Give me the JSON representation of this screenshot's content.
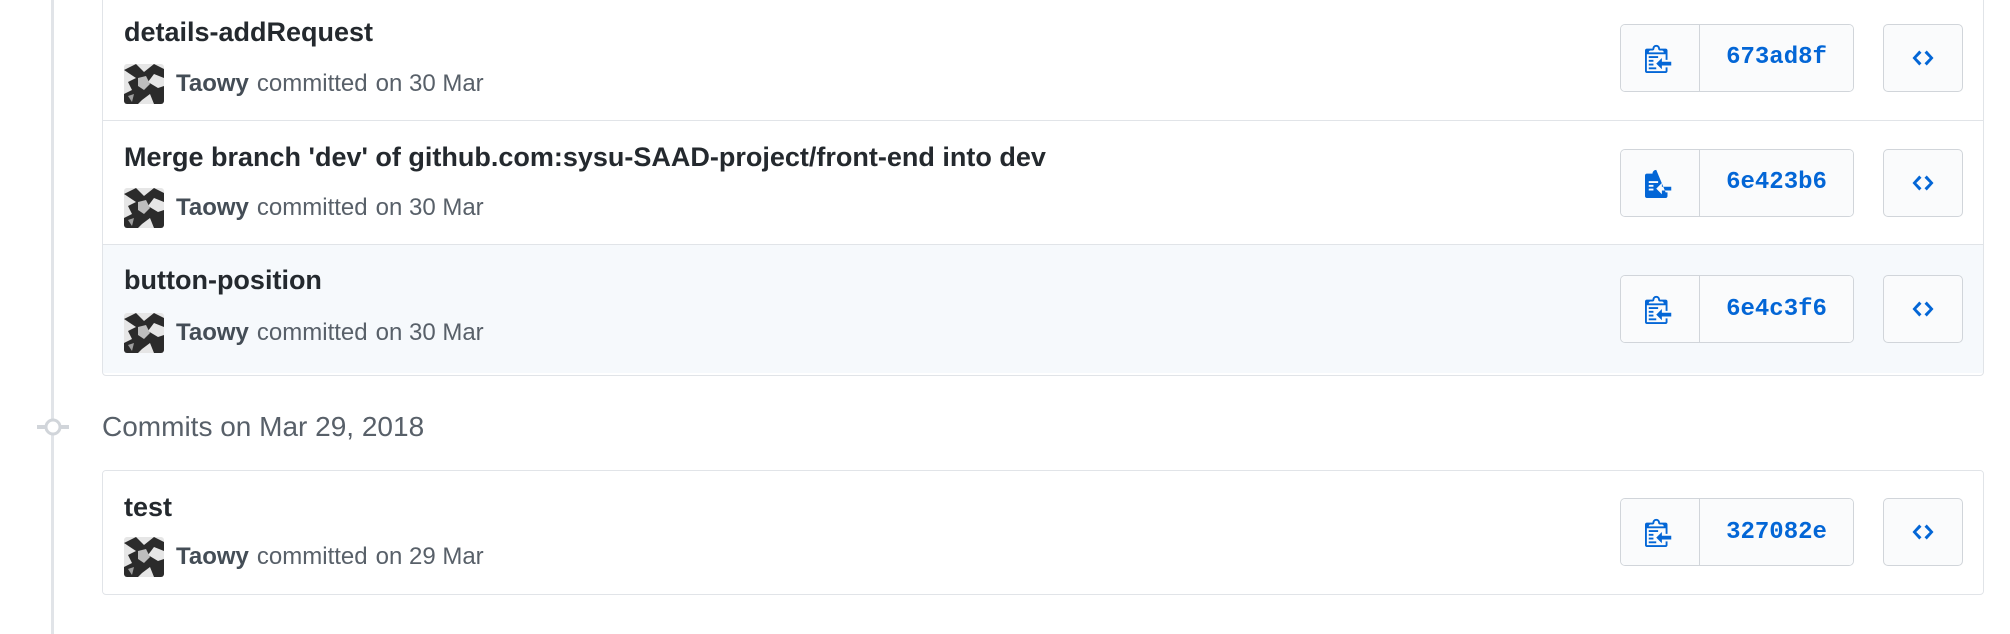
{
  "commit_groups": [
    {
      "heading": "",
      "commits": [
        {
          "title": "details-addRequest",
          "author": "Taowy",
          "action": "committed",
          "date": "on 30 Mar",
          "sha": "673ad8f"
        },
        {
          "title": "Merge branch 'dev' of github.com:sysu-SAAD-project/front-end into dev",
          "author": "Taowy",
          "action": "committed",
          "date": "on 30 Mar",
          "sha": "6e423b6"
        },
        {
          "title": "button-position",
          "author": "Taowy",
          "action": "committed",
          "date": "on 30 Mar",
          "sha": "6e4c3f6"
        }
      ]
    },
    {
      "heading": "Commits on Mar 29, 2018",
      "commits": [
        {
          "title": "test",
          "author": "Taowy",
          "action": "committed",
          "date": "on 29 Mar",
          "sha": "327082e"
        }
      ]
    }
  ],
  "icons": {
    "copy": "clippy-icon",
    "browse": "code-icon",
    "timeline": "git-commit-icon",
    "avatar": "user-avatar"
  },
  "colors": {
    "link_blue": "#0366d6",
    "border": "#e1e4e8",
    "hover_row": "#f6f9fc",
    "meta_text": "#586069"
  }
}
